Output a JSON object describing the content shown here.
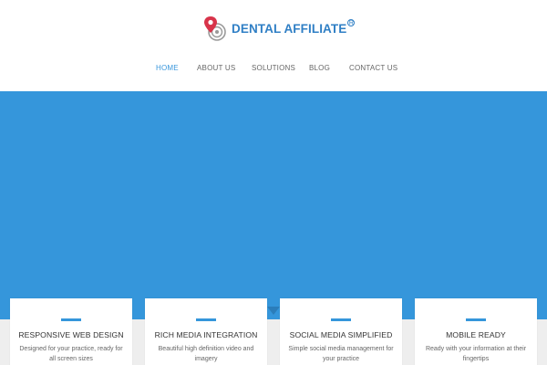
{
  "brand": {
    "name": "DENTAL AFFILIATE",
    "registered": "R",
    "colors": {
      "primary": "#2f7fc5",
      "accent": "#d8344a"
    }
  },
  "nav": {
    "items": [
      {
        "label": "HOME",
        "active": true
      },
      {
        "label": "ABOUT US",
        "active": false
      },
      {
        "label": "SOLUTIONS",
        "active": false
      },
      {
        "label": "BLOG",
        "active": false
      },
      {
        "label": "CONTACT US",
        "active": false
      }
    ]
  },
  "hero": {
    "background": "#3596db"
  },
  "features": [
    {
      "title": "RESPONSIVE WEB DESIGN",
      "description": "Designed for your practice, ready for all screen sizes"
    },
    {
      "title": "RICH MEDIA INTEGRATION",
      "description": "Beautiful high definition video and imagery"
    },
    {
      "title": "SOCIAL MEDIA SIMPLIFIED",
      "description": "Simple social media management for your practice"
    },
    {
      "title": "MOBILE READY",
      "description": "Ready with your information at their fingertips"
    }
  ]
}
